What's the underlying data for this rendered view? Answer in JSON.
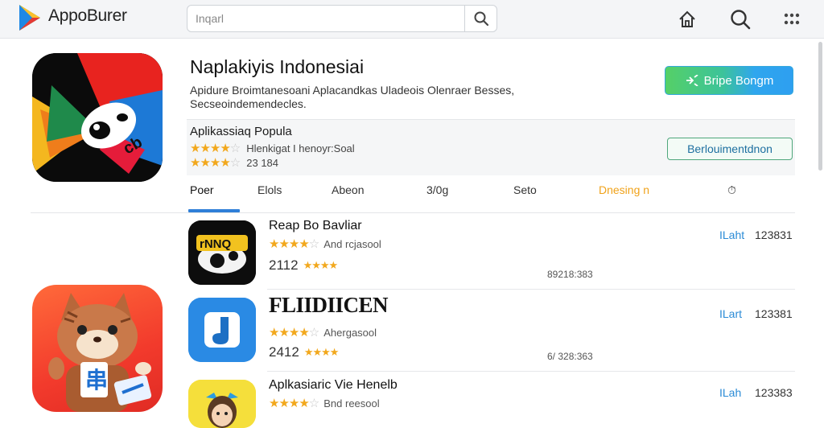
{
  "header": {
    "brand": "AppoBurer",
    "search_placeholder": "Inqarl",
    "icons": [
      "home-icon",
      "search-icon",
      "more-icon"
    ]
  },
  "app": {
    "title": "Naplakiyis Indonesiai",
    "description": "Apidure Broimtanesoani Aplacandkas Uladeois Olenraer Besses, Secseoindemendecles.",
    "install_label": "Bripe Bongm",
    "info_label": "Aplikassiaq Popula",
    "info_row1_text": "Hlenkigat I henoyr:Soal",
    "info_row2_text": "23 184",
    "outline_button_label": "Berlouimentdnon",
    "rating": 4
  },
  "tabs": [
    {
      "label": "Poer",
      "active": true
    },
    {
      "label": "Elols",
      "active": false
    },
    {
      "label": "Abeon",
      "active": false
    },
    {
      "label": "3/0g",
      "active": false
    },
    {
      "label": "Seto",
      "active": false
    },
    {
      "label": "Dnesing n",
      "active": false
    },
    {
      "label": "⏱",
      "active": false
    }
  ],
  "list": [
    {
      "title": "Reap Bo Bavliar",
      "developer": "And rcjasool",
      "rating_text": "2112",
      "meta": "89218:383",
      "action": "ILaht",
      "count": "123831"
    },
    {
      "title": "FLIIDIICEN",
      "developer": "Ahergasool",
      "rating_text": "2412",
      "meta": "6/ 328:363",
      "action": "ILart",
      "count": "123381"
    },
    {
      "title": "Aplkasiaric Vie Henelb",
      "developer": "Bnd reesool",
      "rating_text": "",
      "meta": "",
      "action": "ILah",
      "count": "123383"
    }
  ],
  "colors": {
    "accent_blue": "#2f7fd8",
    "install_green": "#55d067",
    "install_blue": "#2e9ff0",
    "star": "#f2a81d",
    "dnesing_tab": "#f0a21a"
  }
}
